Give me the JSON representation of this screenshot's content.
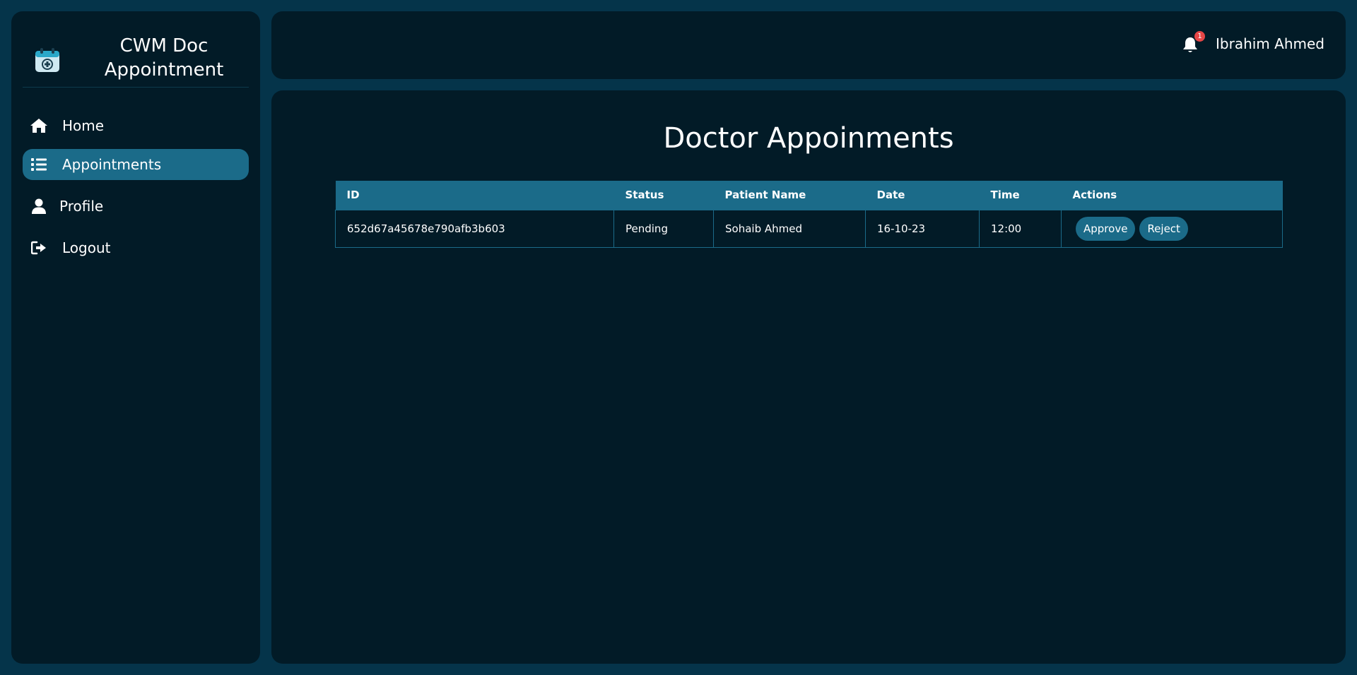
{
  "sidebar": {
    "brand_line1": "CWM Doc",
    "brand_line2": "Appointment",
    "items": [
      {
        "label": "Home",
        "icon": "home-icon"
      },
      {
        "label": "Appointments",
        "icon": "list-icon",
        "active": true
      },
      {
        "label": "Profile",
        "icon": "user-icon"
      },
      {
        "label": "Logout",
        "icon": "logout-icon"
      }
    ]
  },
  "header": {
    "notification_count": "1",
    "user_name": "Ibrahim Ahmed"
  },
  "main": {
    "title": "Doctor Appoinments",
    "table": {
      "columns": [
        "ID",
        "Status",
        "Patient Name",
        "Date",
        "Time",
        "Actions"
      ],
      "rows": [
        {
          "id": "652d67a45678e790afb3b603",
          "status": "Pending",
          "patient_name": "Sohaib Ahmed",
          "date": "16-10-23",
          "time": "12:00",
          "approve_label": "Approve",
          "reject_label": "Reject"
        }
      ]
    }
  },
  "colors": {
    "page_bg": "#05344a",
    "panel_bg": "#021b27",
    "accent": "#1b6b89",
    "badge": "#e64646"
  }
}
